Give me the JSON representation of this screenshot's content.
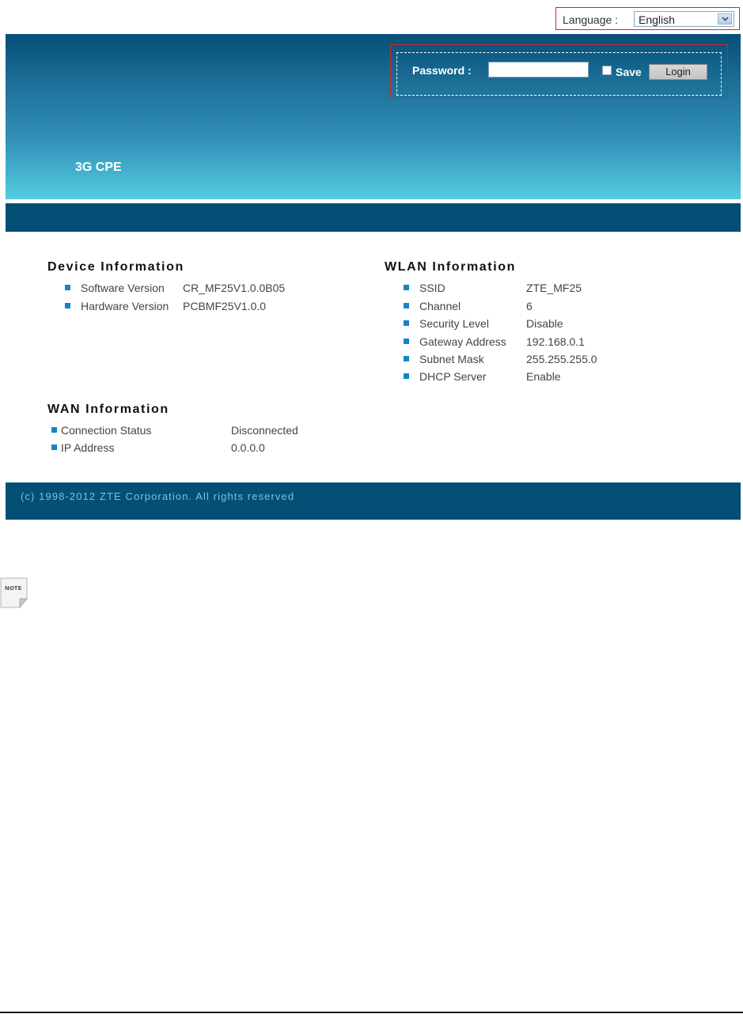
{
  "language": {
    "label": "Language :",
    "selected": "English"
  },
  "header": {
    "product_name": "3G CPE",
    "password_label": "Password :",
    "save_label": "Save",
    "login_label": "Login"
  },
  "device_info": {
    "title": "Device Information",
    "rows": [
      {
        "label": "Software Version",
        "value": "CR_MF25V1.0.0B05"
      },
      {
        "label": "Hardware Version",
        "value": "PCBMF25V1.0.0"
      }
    ]
  },
  "wlan_info": {
    "title": "WLAN Information",
    "rows": [
      {
        "label": "SSID",
        "value": "ZTE_MF25"
      },
      {
        "label": "Channel",
        "value": "6"
      },
      {
        "label": "Security Level",
        "value": "Disable"
      },
      {
        "label": "Gateway Address",
        "value": "192.168.0.1"
      },
      {
        "label": "Subnet Mask",
        "value": "255.255.255.0"
      },
      {
        "label": "DHCP Server",
        "value": "Enable"
      }
    ]
  },
  "wan_info": {
    "title": "WAN Information",
    "rows": [
      {
        "label": "Connection Status",
        "value": "Disconnected"
      },
      {
        "label": "IP Address",
        "value": "0.0.0.0"
      }
    ]
  },
  "footer": {
    "copyright": "(c) 1998-2012 ZTE Corporation. All rights reserved"
  },
  "note_icon": {
    "label": "NOTE"
  },
  "colors": {
    "banner_dark": "#054f77",
    "banner_light": "#55cbe0",
    "nav_bar": "#044f76",
    "bullet": "#1585c4",
    "highlight_box": "#d0262c"
  }
}
